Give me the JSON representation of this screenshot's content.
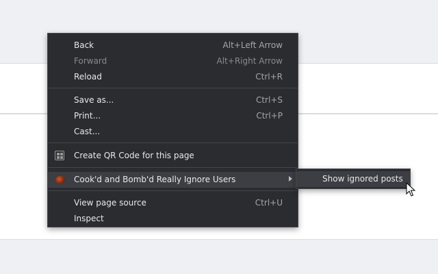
{
  "context_menu": {
    "items": [
      {
        "label": "Back",
        "shortcut": "Alt+Left Arrow"
      },
      {
        "label": "Forward",
        "shortcut": "Alt+Right Arrow",
        "disabled": true
      },
      {
        "label": "Reload",
        "shortcut": "Ctrl+R"
      },
      {
        "label": "Save as...",
        "shortcut": "Ctrl+S"
      },
      {
        "label": "Print...",
        "shortcut": "Ctrl+P"
      },
      {
        "label": "Cast..."
      },
      {
        "label": "Create QR Code for this page",
        "icon": "qr-code-icon"
      },
      {
        "label": "Cook'd and Bomb'd Really Ignore Users",
        "icon": "extension-icon",
        "has_submenu": true
      },
      {
        "label": "View page source",
        "shortcut": "Ctrl+U"
      },
      {
        "label": "Inspect"
      }
    ]
  },
  "submenu": {
    "items": [
      {
        "label": "Show ignored posts"
      }
    ]
  },
  "colors": {
    "menu_background": "#2b2c30",
    "highlight": "#3d3e43",
    "page_background": "#eef0f4"
  }
}
